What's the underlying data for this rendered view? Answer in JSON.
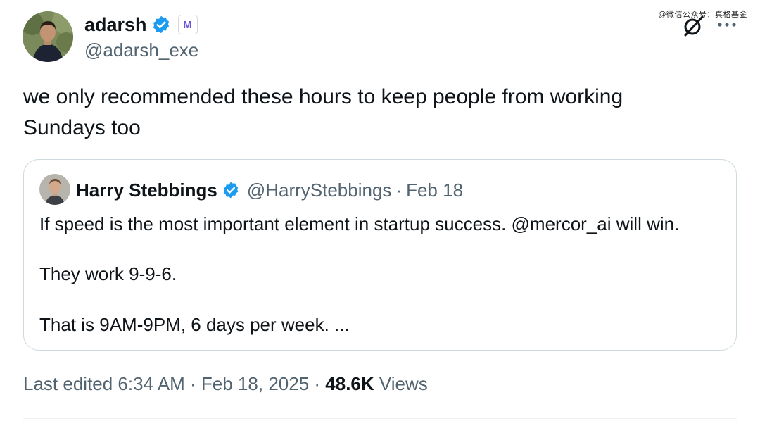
{
  "author": {
    "display_name": "adarsh",
    "handle": "@adarsh_exe",
    "badge_letter": "M",
    "verified_color": "#1d9bf0"
  },
  "watermark": "@微信公众号：真格基金",
  "tweet": {
    "text_line1": "we only recommended these hours to keep people from working",
    "text_line2": "Sundays too"
  },
  "quoted": {
    "display_name": "Harry Stebbings",
    "handle": "@HarryStebbings",
    "separator": "·",
    "date": "Feb 18",
    "lines": [
      "If speed is the most important element in startup success. @mercor_ai will win.",
      "They work 9-9-6.",
      "That is 9AM-9PM, 6 days per week. ..."
    ]
  },
  "meta": {
    "edited_label": "Last edited 6:34 AM · Feb 18, 2025 ·",
    "views_count": "48.6K",
    "views_label": "Views"
  },
  "icons": {
    "grok": "grok-icon",
    "more": "more-icon"
  }
}
